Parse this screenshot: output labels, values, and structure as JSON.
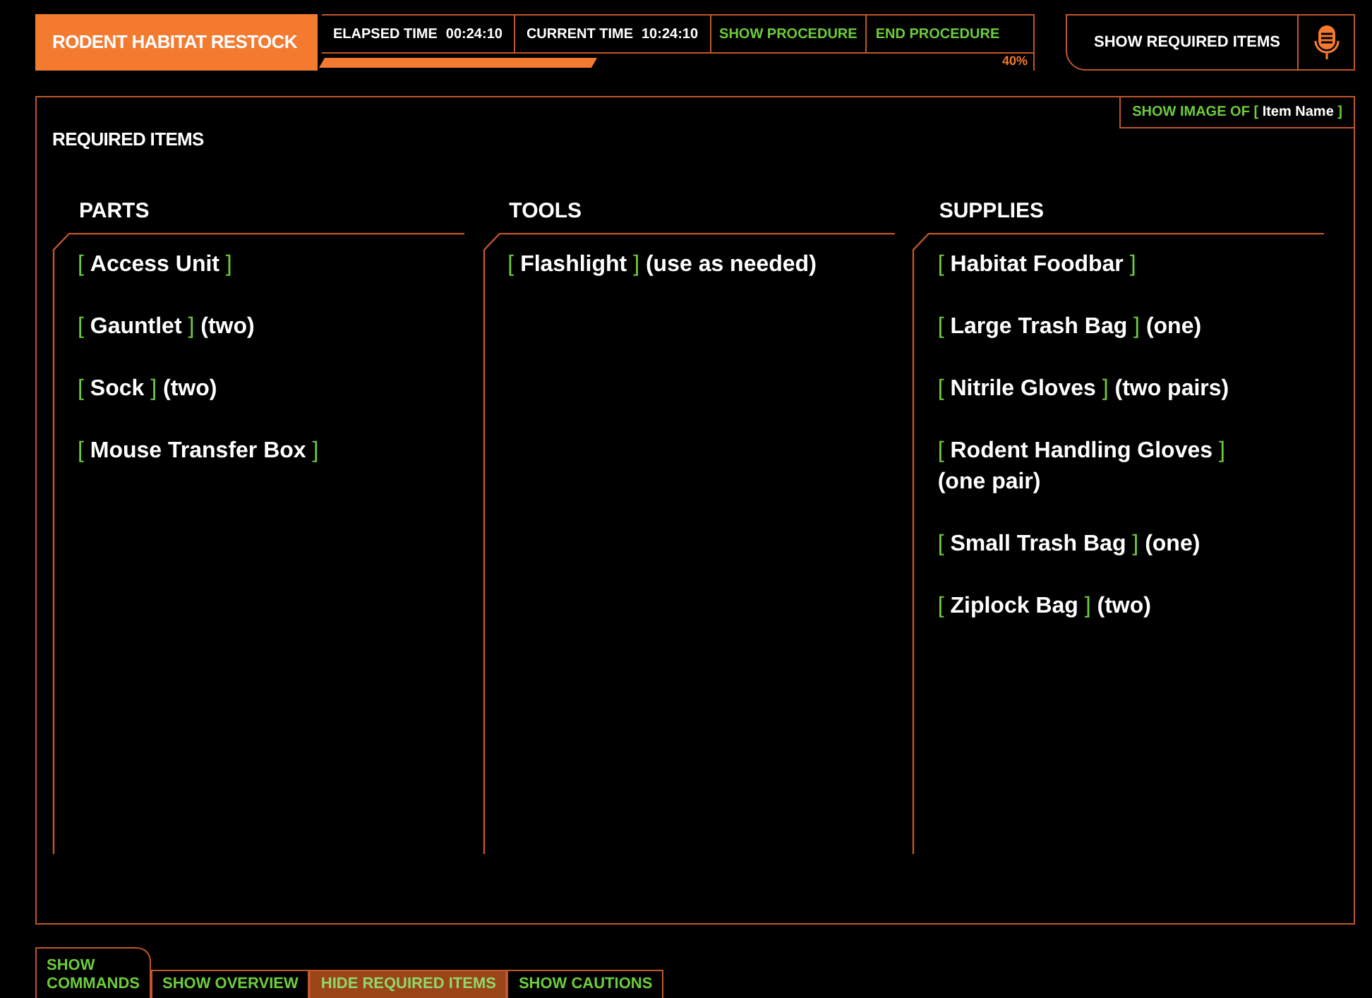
{
  "header": {
    "title": "RODENT HABITAT RESTOCK",
    "elapsed": {
      "label": "ELAPSED TIME",
      "value": "00:24:10"
    },
    "current": {
      "label": "CURRENT TIME",
      "value": "10:24:10"
    },
    "actions": [
      "SHOW PROCEDURE",
      "END PROCEDURE"
    ],
    "progress": {
      "level": 0.4,
      "reading": "40%"
    },
    "right_button": "SHOW REQUIRED ITEMS"
  },
  "panel": {
    "title": "REQUIRED ITEMS",
    "image_button": {
      "label": "SHOW IMAGE OF",
      "open": "[",
      "name": "Item Name",
      "close": "]"
    },
    "columns": [
      {
        "heading": "PARTS",
        "items": [
          {
            "open": "[",
            "name": "Access Unit",
            "close": "]"
          },
          {
            "open": "[",
            "name": "Gauntlet",
            "close": "]",
            "note": "(two)"
          },
          {
            "open": "[",
            "name": "Sock",
            "close": "]",
            "note": "(two)"
          },
          {
            "open": "[",
            "name": "Mouse Transfer Box",
            "close": "]"
          }
        ]
      },
      {
        "heading": "TOOLS",
        "items": [
          {
            "open": "[",
            "name": "Flashlight",
            "close": "]",
            "note": "(use as needed)"
          }
        ]
      },
      {
        "heading": "SUPPLIES",
        "items": [
          {
            "open": "[",
            "name": "Habitat Foodbar",
            "close": "]"
          },
          {
            "open": "[",
            "name": "Large Trash Bag",
            "close": "]",
            "note": "(one)"
          },
          {
            "open": "[",
            "name": "Nitrile Gloves",
            "close": "]",
            "note": "(two pairs)"
          },
          {
            "open": "[",
            "name": "Rodent Handling Gloves",
            "close": "]",
            "note": "(one pair)"
          },
          {
            "open": "[",
            "name": "Small Trash Bag",
            "close": "]",
            "note": "(one)"
          },
          {
            "open": "[",
            "name": "Ziplock Bag",
            "close": "]",
            "note": "(two)"
          }
        ]
      }
    ]
  },
  "bottom_tabs": [
    {
      "label": "SHOW COMMANDS",
      "selected": false,
      "kind": "tall"
    },
    {
      "label": "SHOW OVERVIEW",
      "selected": false,
      "kind": "flat"
    },
    {
      "label": "HIDE REQUIRED ITEMS",
      "selected": true,
      "kind": "flat"
    },
    {
      "label": "SHOW CAUTIONS",
      "selected": false,
      "kind": "flat"
    }
  ]
}
